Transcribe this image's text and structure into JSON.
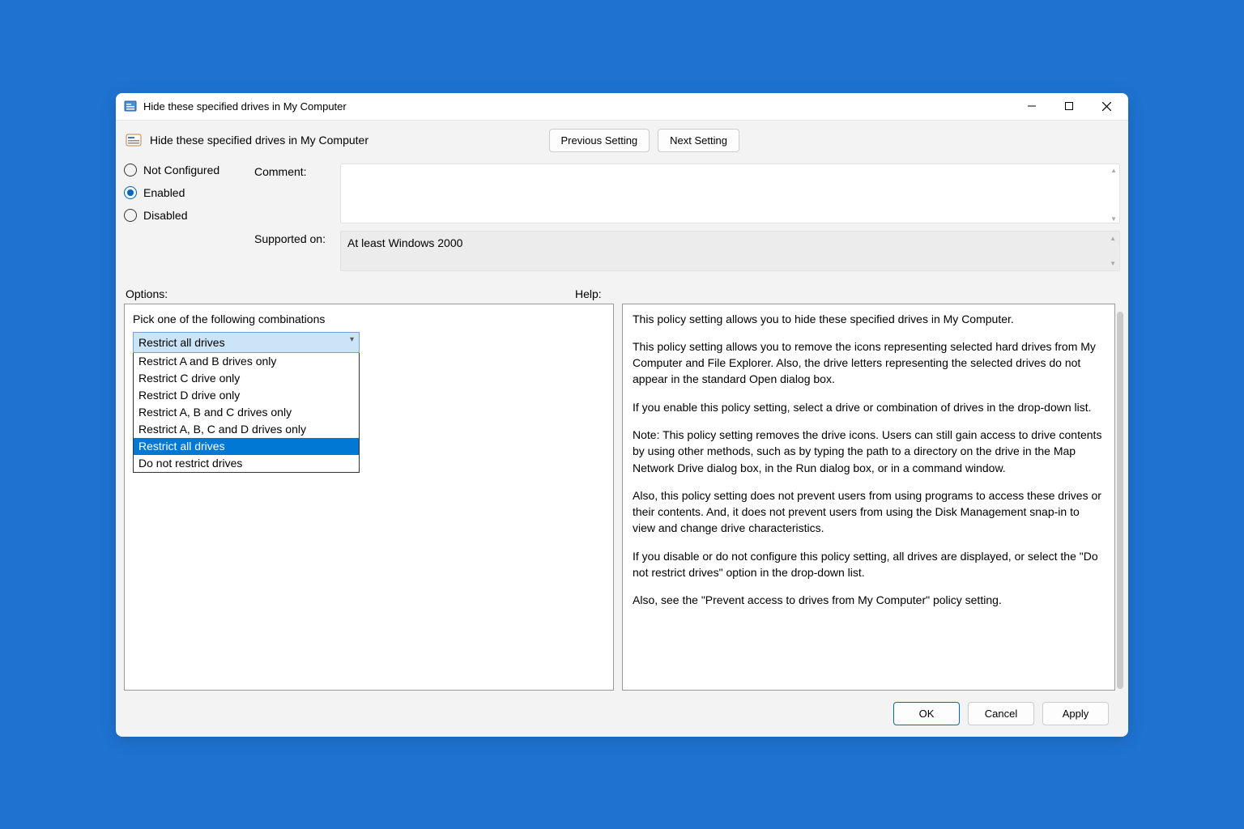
{
  "window": {
    "title": "Hide these specified drives in My Computer"
  },
  "header": {
    "policy_title": "Hide these specified drives in My Computer",
    "prev_button": "Previous Setting",
    "next_button": "Next Setting"
  },
  "state": {
    "radios": {
      "not_configured": "Not Configured",
      "enabled": "Enabled",
      "disabled": "Disabled",
      "selected": "enabled"
    },
    "comment_label": "Comment:",
    "comment_value": "",
    "supported_label": "Supported on:",
    "supported_value": "At least Windows 2000"
  },
  "sections": {
    "options_label": "Options:",
    "help_label": "Help:"
  },
  "options": {
    "combo_label": "Pick one of the following combinations",
    "combo_selected": "Restrict all drives",
    "dropdown": [
      "Restrict A and B drives only",
      "Restrict C drive only",
      "Restrict D drive only",
      "Restrict A, B and C drives only",
      "Restrict A, B, C and D drives only",
      "Restrict all drives",
      "Do not restrict drives"
    ],
    "dropdown_highlight_index": 5
  },
  "help": {
    "p1": "This policy setting allows you to hide these specified drives in My Computer.",
    "p2": "This policy setting allows you to remove the icons representing selected hard drives from My Computer and File Explorer. Also, the drive letters representing the selected drives do not appear in the standard Open dialog box.",
    "p3": "If you enable this policy setting, select a drive or combination of drives in the drop-down list.",
    "p4": "Note: This policy setting removes the drive icons. Users can still gain access to drive contents by using other methods, such as by typing the path to a directory on the drive in the Map Network Drive dialog box, in the Run dialog box, or in a command window.",
    "p5": "Also, this policy setting does not prevent users from using programs to access these drives or their contents. And, it does not prevent users from using the Disk Management snap-in to view and change drive characteristics.",
    "p6": "If you disable or do not configure this policy setting, all drives are displayed, or select the \"Do not restrict drives\" option in the drop-down list.",
    "p7": "Also, see the \"Prevent access to drives from My Computer\" policy setting."
  },
  "footer": {
    "ok": "OK",
    "cancel": "Cancel",
    "apply": "Apply"
  }
}
